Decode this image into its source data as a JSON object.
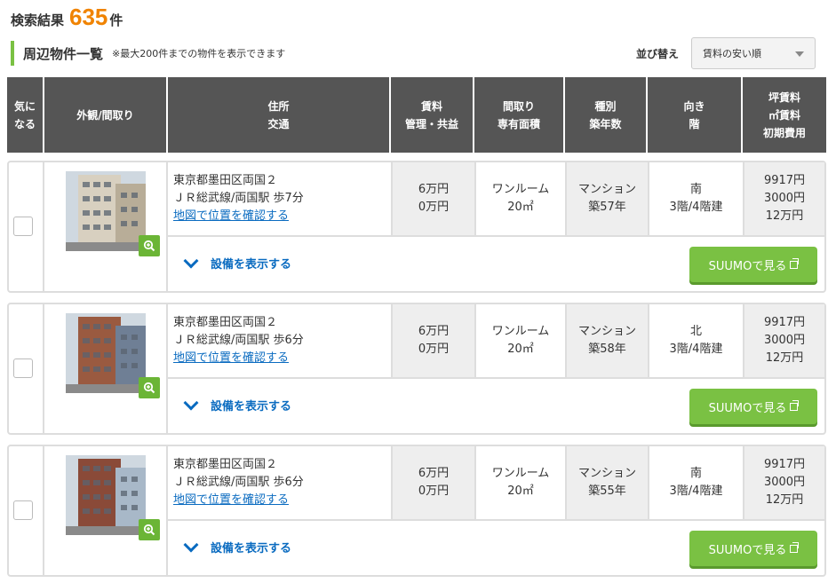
{
  "result": {
    "label": "検索結果",
    "count": "635",
    "unit": "件"
  },
  "section": {
    "title": "周辺物件一覧",
    "note": "※最大200件までの物件を表示できます"
  },
  "sort": {
    "label": "並び替え",
    "selected": "賃料の安い順"
  },
  "headers": {
    "fav": [
      "気に",
      "なる"
    ],
    "photo": [
      "外観/間取り"
    ],
    "address": [
      "住所",
      "交通"
    ],
    "rent": [
      "賃料",
      "管理・共益"
    ],
    "layout": [
      "間取り",
      "専有面積"
    ],
    "type": [
      "種別",
      "築年数"
    ],
    "direction": [
      "向き",
      "階"
    ],
    "unit_price": [
      "坪賃料",
      "㎡賃料",
      "初期費用"
    ]
  },
  "listings": [
    {
      "address": "東京都墨田区両国２",
      "access": "ＪＲ総武線/両国駅 歩7分",
      "map_link": "地図で位置を確認する",
      "rent": "6万円",
      "fee": "0万円",
      "layout": "ワンルーム",
      "area": "20㎡",
      "type": "マンション",
      "age": "築57年",
      "direction": "南",
      "floor": "3階/4階建",
      "tsubo": "9917円",
      "sqm": "3000円",
      "initial": "12万円",
      "equip": "設備を表示する",
      "suumo": "SUUMOで見る",
      "photo_colors": [
        "#d8d0c0",
        "#b8ad98"
      ]
    },
    {
      "address": "東京都墨田区両国２",
      "access": "ＪＲ総武線/両国駅 歩6分",
      "map_link": "地図で位置を確認する",
      "rent": "6万円",
      "fee": "0万円",
      "layout": "ワンルーム",
      "area": "20㎡",
      "type": "マンション",
      "age": "築58年",
      "direction": "北",
      "floor": "3階/4階建",
      "tsubo": "9917円",
      "sqm": "3000円",
      "initial": "12万円",
      "equip": "設備を表示する",
      "suumo": "SUUMOで見る",
      "photo_colors": [
        "#9a5a40",
        "#6f7f95"
      ]
    },
    {
      "address": "東京都墨田区両国２",
      "access": "ＪＲ総武線/両国駅 歩6分",
      "map_link": "地図で位置を確認する",
      "rent": "6万円",
      "fee": "0万円",
      "layout": "ワンルーム",
      "area": "20㎡",
      "type": "マンション",
      "age": "築55年",
      "direction": "南",
      "floor": "3階/4階建",
      "tsubo": "9917円",
      "sqm": "3000円",
      "initial": "12万円",
      "equip": "設備を表示する",
      "suumo": "SUUMOで見る",
      "photo_colors": [
        "#8a4a38",
        "#a8b8c8"
      ]
    }
  ]
}
